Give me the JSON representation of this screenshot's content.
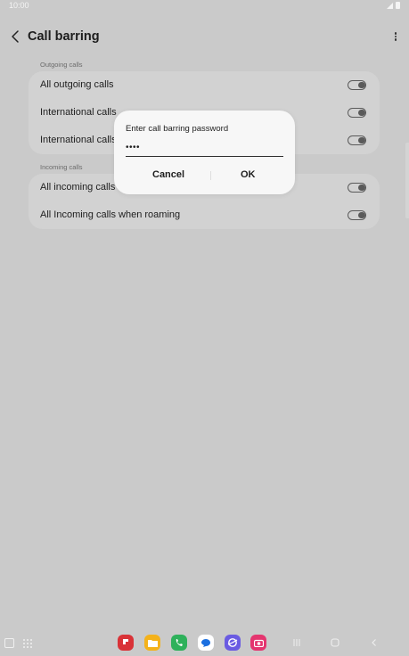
{
  "status_bar": {
    "time": "10:00"
  },
  "app_bar": {
    "title": "Call barring"
  },
  "sections": [
    {
      "header": "Outgoing calls",
      "rows": [
        {
          "label": "All outgoing calls",
          "enabled": false
        },
        {
          "label": "International calls",
          "enabled": false
        },
        {
          "label": "International calls",
          "enabled": false
        }
      ]
    },
    {
      "header": "Incoming calls",
      "rows": [
        {
          "label": "All incoming calls",
          "enabled": false
        },
        {
          "label": "All Incoming calls when roaming",
          "enabled": false
        }
      ]
    }
  ],
  "dialog": {
    "title": "Enter call barring password",
    "password_value": "••••",
    "cancel_label": "Cancel",
    "ok_label": "OK"
  },
  "taskbar": {
    "apps": [
      {
        "icon": "flipboard-icon",
        "color": "#d93237"
      },
      {
        "icon": "my-files-icon",
        "color": "#f4b21b"
      },
      {
        "icon": "phone-icon",
        "color": "#2eb15b"
      },
      {
        "icon": "messages-icon",
        "color": "#ffffff"
      },
      {
        "icon": "internet-icon",
        "color": "#6a5be2"
      },
      {
        "icon": "camera-icon",
        "color": "#e4356f"
      }
    ],
    "nav": [
      "recent-apps-icon",
      "home-icon",
      "back-nav-icon"
    ]
  },
  "colors": {
    "background": "#cacaca",
    "card": "#d2d2d2",
    "dialog": "#f7f7f7"
  }
}
